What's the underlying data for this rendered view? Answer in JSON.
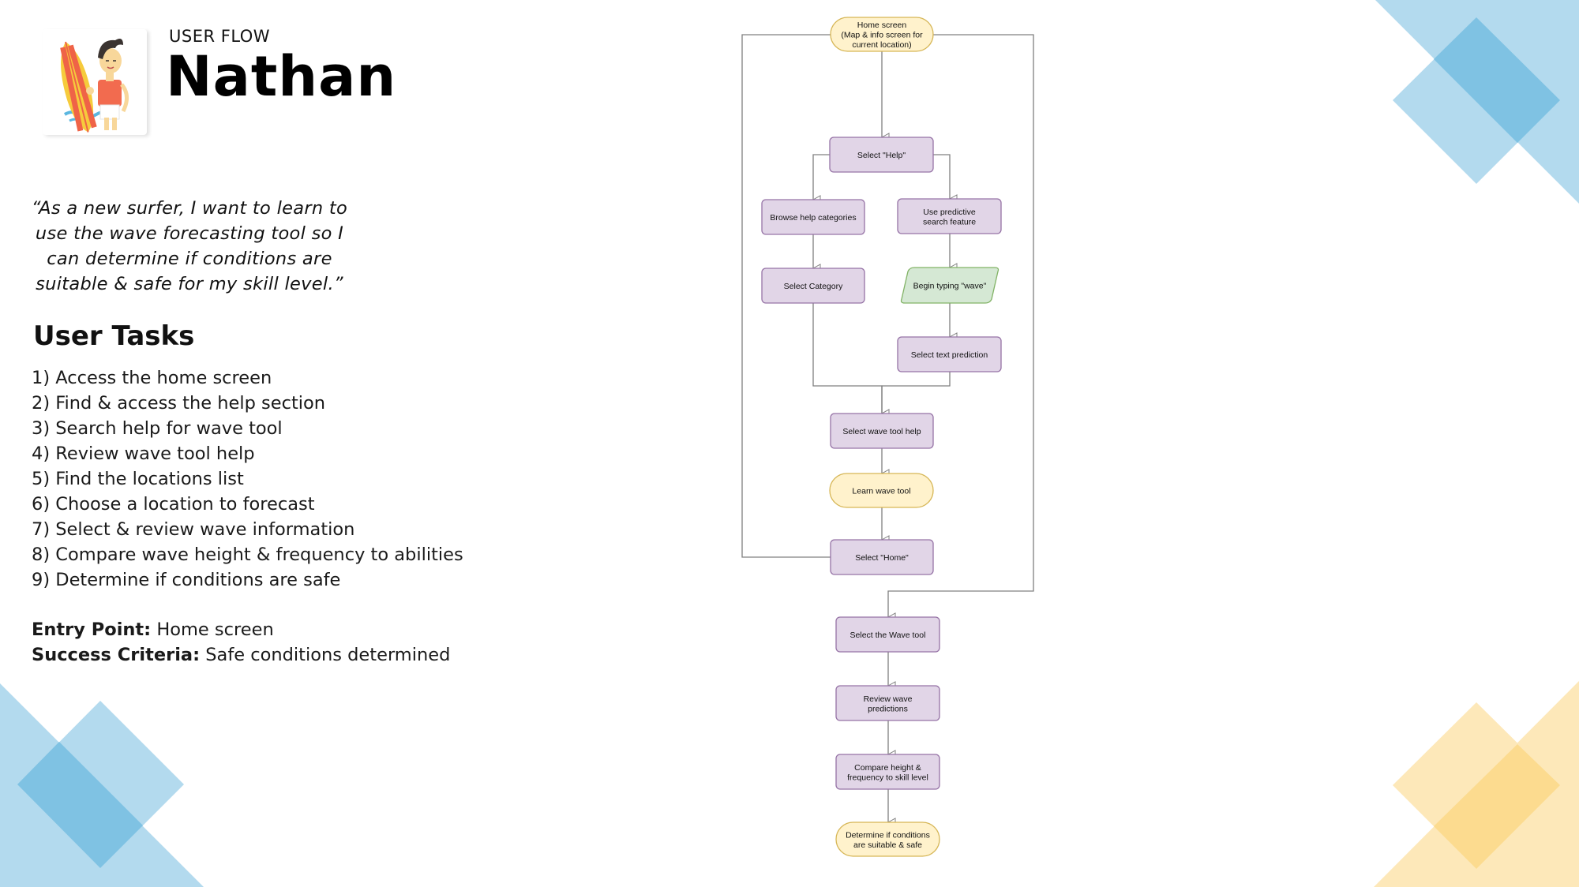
{
  "header": {
    "eyebrow": "USER FLOW",
    "persona_name": "Nathan",
    "avatar": "surfer-avatar-illustration"
  },
  "quote": [
    "“As a new surfer, I want to learn to",
    "use the wave forecasting tool so I",
    "can determine if conditions are",
    "suitable & safe for my skill level.”"
  ],
  "tasks": {
    "heading": "User Tasks",
    "items": [
      "1) Access the home screen",
      "2) Find & access the help section",
      "3) Search help for wave tool",
      "4) Review wave tool help",
      "5) Find the locations list",
      "6) Choose a location to forecast",
      "7) Select & review wave information",
      "8) Compare wave height & frequency to abilities",
      "9) Determine if conditions are safe"
    ]
  },
  "meta": {
    "entry_label": "Entry Point:",
    "entry_value": " Home screen",
    "success_label": "Success Criteria:",
    "success_value": " Safe conditions determined"
  },
  "colors": {
    "process_fill": "#e1d5e7",
    "process_stroke": "#9673a6",
    "terminal_fill": "#fff2cc",
    "terminal_stroke": "#d6b656",
    "io_fill": "#d5e8d4",
    "io_stroke": "#82b366",
    "connector": "#808080",
    "deco_blue": "#b3daee",
    "deco_blue_dark": "#7fc2e3",
    "deco_yellow": "#fde8b9",
    "deco_yellow_dark": "#fcdb8f"
  },
  "flow": {
    "nodes": [
      {
        "id": "home",
        "shape": "terminal",
        "lines": [
          "Home screen",
          "(Map & info screen for",
          "current location)"
        ]
      },
      {
        "id": "select-help",
        "shape": "process",
        "lines": [
          "Select \"Help\""
        ]
      },
      {
        "id": "browse-categories",
        "shape": "process",
        "lines": [
          "Browse help categories"
        ]
      },
      {
        "id": "predictive-search",
        "shape": "process",
        "lines": [
          "Use predictive",
          "search feature"
        ]
      },
      {
        "id": "select-category",
        "shape": "process",
        "lines": [
          "Select Category"
        ]
      },
      {
        "id": "begin-typing",
        "shape": "io",
        "lines": [
          "Begin typing \"wave\""
        ]
      },
      {
        "id": "select-prediction",
        "shape": "process",
        "lines": [
          "Select text prediction"
        ]
      },
      {
        "id": "wave-tool-help",
        "shape": "process",
        "lines": [
          "Select wave tool help"
        ]
      },
      {
        "id": "learn-wave-tool",
        "shape": "terminal",
        "lines": [
          "Learn wave tool"
        ]
      },
      {
        "id": "select-home",
        "shape": "process",
        "lines": [
          "Select \"Home\""
        ]
      },
      {
        "id": "select-wave-tool",
        "shape": "process",
        "lines": [
          "Select the Wave tool"
        ]
      },
      {
        "id": "review-predictions",
        "shape": "process",
        "lines": [
          "Review wave",
          "predictions"
        ]
      },
      {
        "id": "compare-height",
        "shape": "process",
        "lines": [
          "Compare height &",
          "frequency to skill level"
        ]
      },
      {
        "id": "determine-safe",
        "shape": "terminal",
        "lines": [
          "Determine if conditions",
          "are suitable & safe"
        ]
      }
    ],
    "edges": [
      [
        "home",
        "select-help"
      ],
      [
        "select-help",
        "browse-categories"
      ],
      [
        "select-help",
        "predictive-search"
      ],
      [
        "browse-categories",
        "select-category"
      ],
      [
        "predictive-search",
        "begin-typing"
      ],
      [
        "begin-typing",
        "select-prediction"
      ],
      [
        "select-category",
        "wave-tool-help"
      ],
      [
        "select-prediction",
        "wave-tool-help"
      ],
      [
        "wave-tool-help",
        "learn-wave-tool"
      ],
      [
        "learn-wave-tool",
        "select-home"
      ],
      [
        "select-home",
        "home"
      ],
      [
        "home",
        "select-wave-tool"
      ],
      [
        "select-wave-tool",
        "review-predictions"
      ],
      [
        "review-predictions",
        "compare-height"
      ],
      [
        "compare-height",
        "determine-safe"
      ]
    ]
  }
}
